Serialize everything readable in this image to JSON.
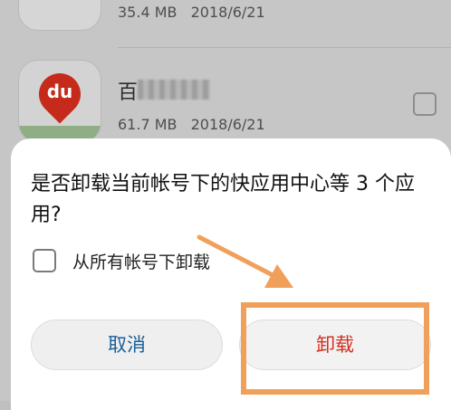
{
  "background_list": {
    "items": [
      {
        "size": "35.4 MB",
        "date": "2018/6/21"
      },
      {
        "name": "百",
        "size": "61.7 MB",
        "date": "2018/6/21",
        "icon_text": "du"
      }
    ]
  },
  "dialog": {
    "message": "是否卸载当前帐号下的快应用中心等 3 个应用?",
    "checkbox_label": "从所有帐号下卸载",
    "cancel_label": "取消",
    "uninstall_label": "卸载"
  },
  "colors": {
    "cancel_text": "#1a5f97",
    "uninstall_text": "#d42f1f",
    "annotation": "#f0a05a"
  }
}
